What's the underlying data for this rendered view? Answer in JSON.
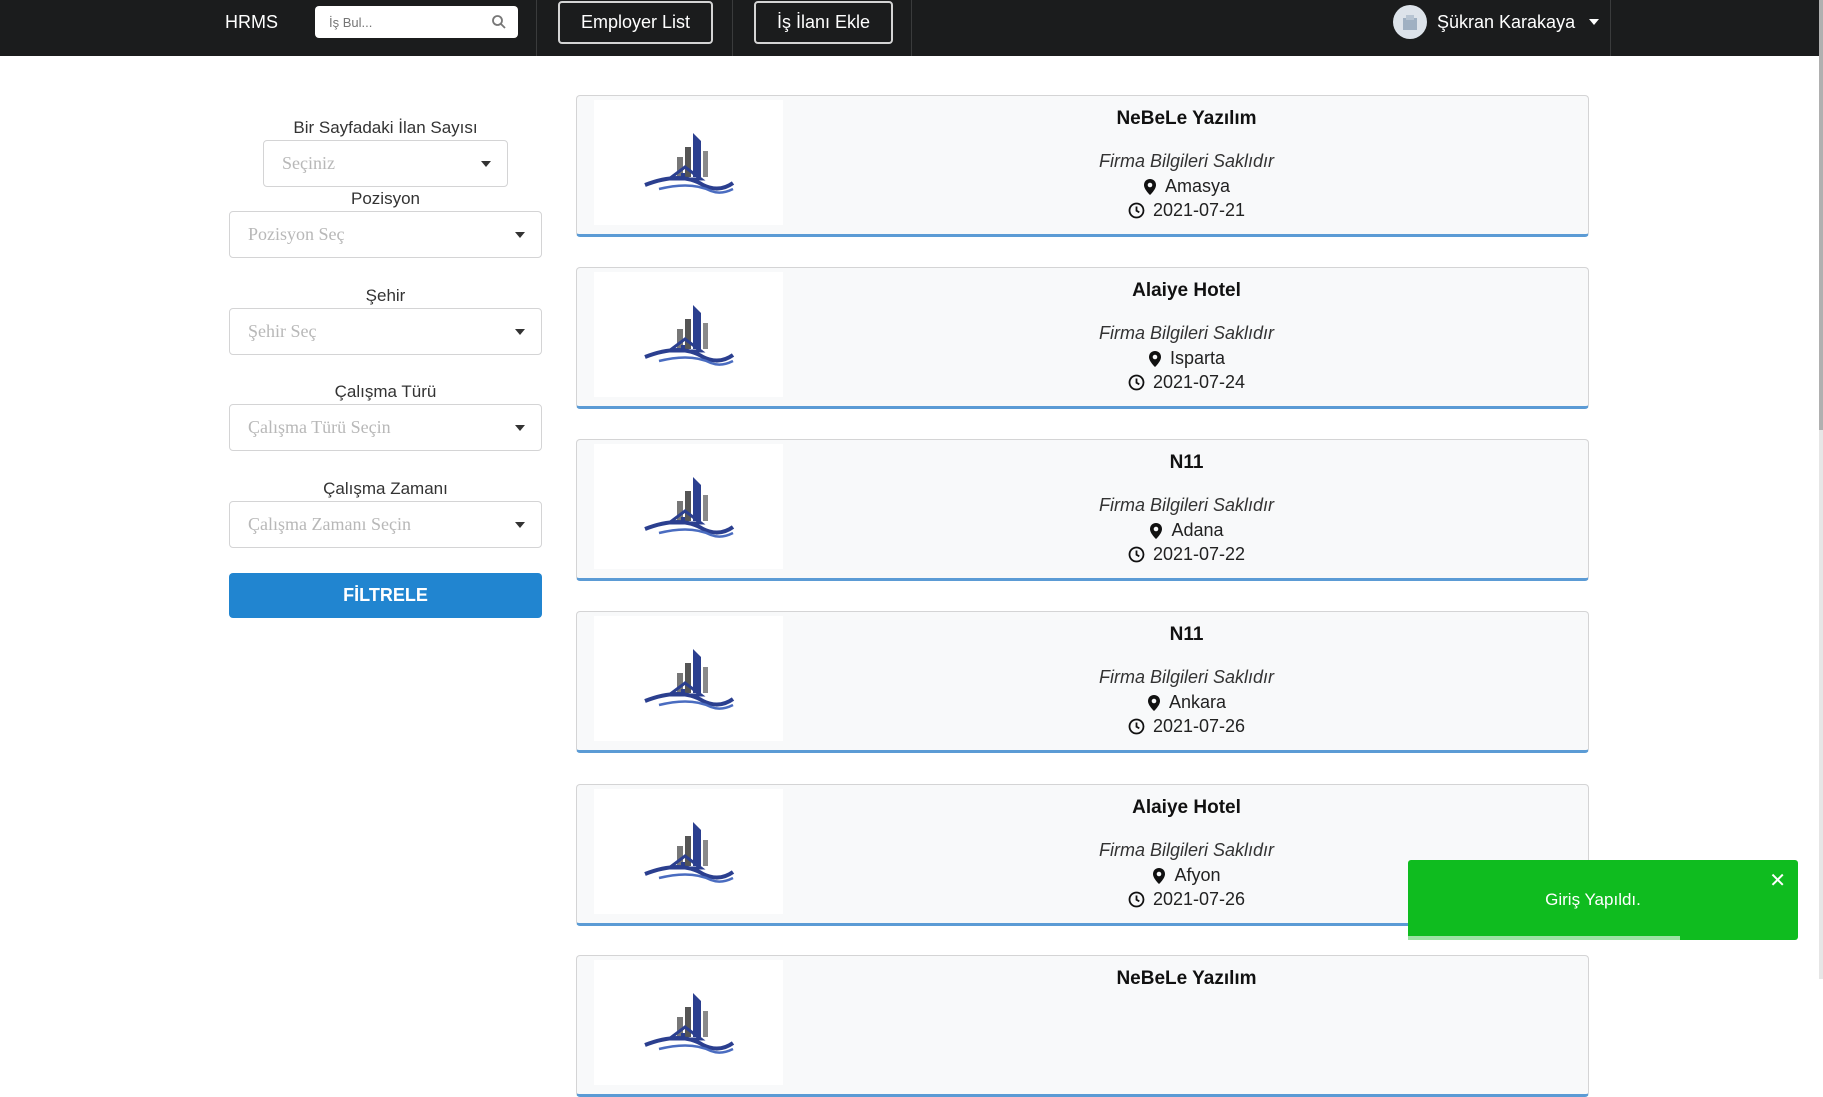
{
  "header": {
    "brand": "HRMS",
    "search_placeholder": "İş Bul...",
    "employer_list": "Employer List",
    "add_job": "İş İlanı Ekle",
    "user_name": "Şükran Karakaya"
  },
  "filters": {
    "per_page_label": "Bir Sayfadaki İlan Sayısı",
    "per_page_placeholder": "Seçiniz",
    "position_label": "Pozisyon",
    "position_placeholder": "Pozisyon Seç",
    "city_label": "Şehir",
    "city_placeholder": "Şehir Seç",
    "work_type_label": "Çalışma Türü",
    "work_type_placeholder": "Çalışma Türü Seçin",
    "work_time_label": "Çalışma Zamanı",
    "work_time_placeholder": "Çalışma Zamanı Seçin",
    "filter_button": "FİLTRELE"
  },
  "jobs": [
    {
      "company": "NeBeLe Yazılım",
      "note": "Firma Bilgileri Saklıdır",
      "city": "Amasya",
      "date": "2021-07-21"
    },
    {
      "company": "Alaiye Hotel",
      "note": "Firma Bilgileri Saklıdır",
      "city": "Isparta",
      "date": "2021-07-24"
    },
    {
      "company": "N11",
      "note": "Firma Bilgileri Saklıdır",
      "city": "Adana",
      "date": "2021-07-22"
    },
    {
      "company": "N11",
      "note": "Firma Bilgileri Saklıdır",
      "city": "Ankara",
      "date": "2021-07-26"
    },
    {
      "company": "Alaiye Hotel",
      "note": "Firma Bilgileri Saklıdır",
      "city": "Afyon",
      "date": "2021-07-26"
    },
    {
      "company": "NeBeLe Yazılım"
    }
  ],
  "toast": {
    "message": "Giriş Yapıldı.",
    "close": "✕"
  },
  "colors": {
    "topbar": "#1b1c1d",
    "primary": "#2185d0",
    "success": "#0fbc1f",
    "card_accent": "#5b9bd5"
  }
}
